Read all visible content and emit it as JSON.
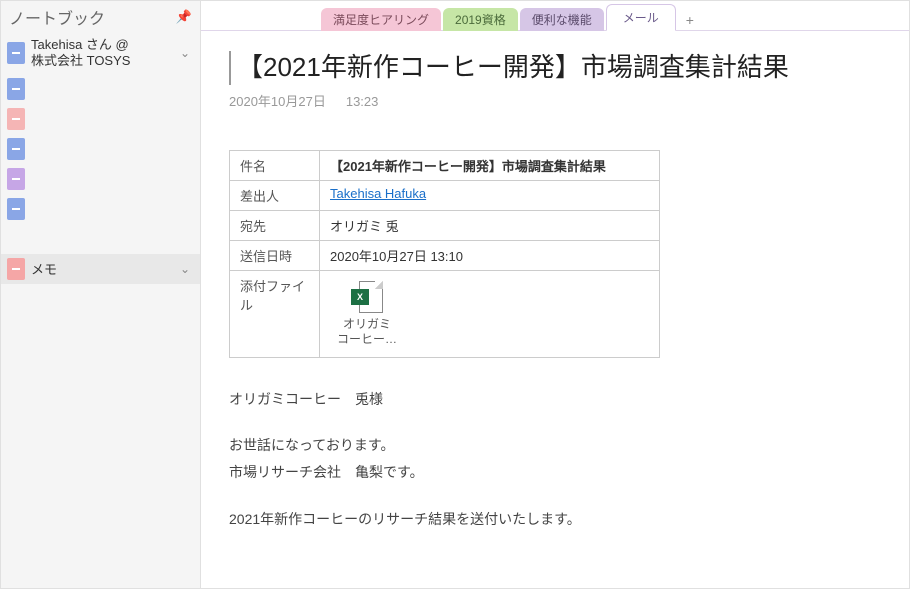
{
  "sidebar": {
    "title": "ノートブック",
    "items": [
      {
        "label_line1": "Takehisa さん @",
        "label_line2": "株式会社 TOSYS",
        "color": "nb-blue",
        "hasChevron": true
      },
      {
        "label": "",
        "color": "nb-blue"
      },
      {
        "label": "",
        "color": "nb-pink"
      },
      {
        "label": "",
        "color": "nb-blue"
      },
      {
        "label": "",
        "color": "nb-purple"
      },
      {
        "label": "",
        "color": "nb-blue"
      },
      {
        "label": "メモ",
        "color": "nb-salmon",
        "hasChevron": true,
        "selected": true
      }
    ]
  },
  "tabs": {
    "items": [
      {
        "label": "満足度ヒアリング",
        "class": "tab-pink"
      },
      {
        "label": "2019資格",
        "class": "tab-green"
      },
      {
        "label": "便利な機能",
        "class": "tab-purple"
      },
      {
        "label": "メール",
        "class": "tab-active"
      }
    ],
    "add": "+"
  },
  "page": {
    "title": "【2021年新作コーヒー開発】市場調査集計結果",
    "date": "2020年10月27日",
    "time": "13:23"
  },
  "mail": {
    "fields": {
      "subject_label": "件名",
      "subject_value": "【2021年新作コーヒー開発】市場調査集計結果",
      "from_label": "差出人",
      "from_value": "Takehisa Hafuka",
      "to_label": "宛先",
      "to_value": "オリガミ 兎",
      "sent_label": "送信日時",
      "sent_value": "2020年10月27日 13:10",
      "attach_label": "添付ファイル",
      "attach_name_line1": "オリガミ",
      "attach_name_line2": "コーヒー…"
    },
    "body": {
      "greeting": "オリガミコーヒー　兎様",
      "line1": "お世話になっております。",
      "line2": "市場リサーチ会社　亀梨です。",
      "line3": "2021年新作コーヒーのリサーチ結果を送付いたします。"
    }
  }
}
